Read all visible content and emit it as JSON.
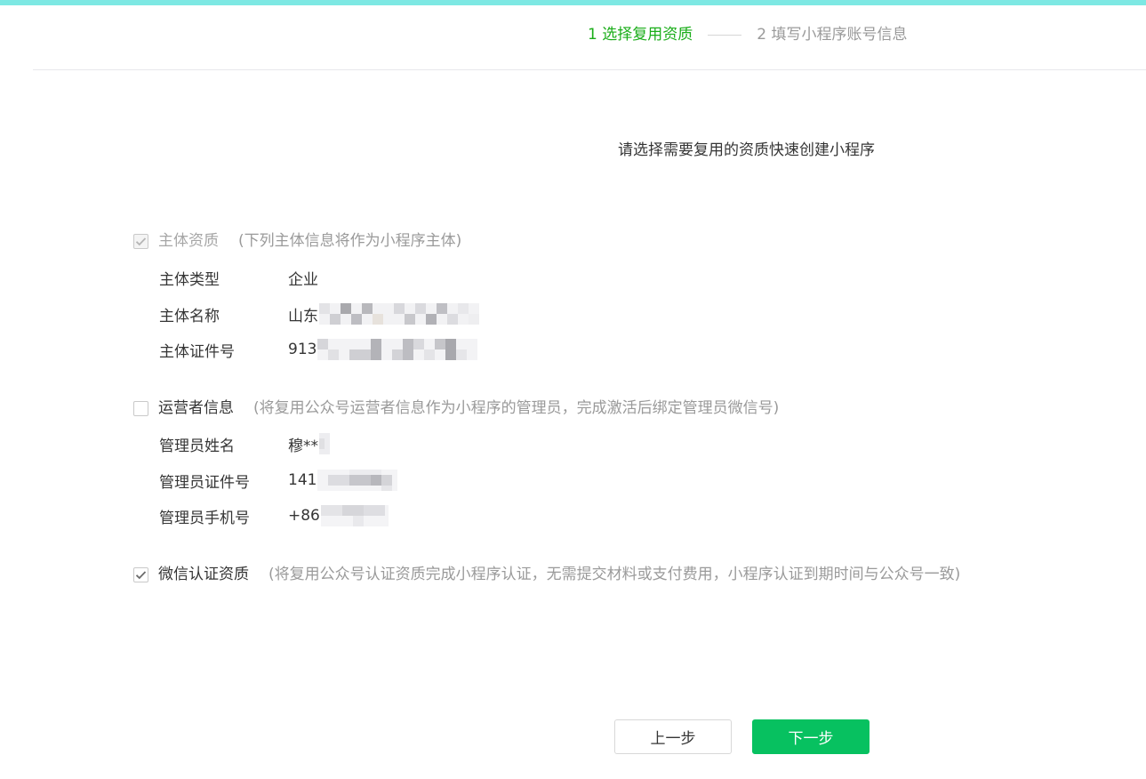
{
  "stepper": {
    "step1": "1 选择复用资质",
    "step2": "2 填写小程序账号信息"
  },
  "instruction": "请选择需要复用的资质快速创建小程序",
  "entity_section": {
    "title": "主体资质",
    "description": "(下列主体信息将作为小程序主体)",
    "checked": true,
    "disabled": true,
    "rows": [
      {
        "label": "主体类型",
        "value": "企业"
      },
      {
        "label": "主体名称",
        "value": "山东"
      },
      {
        "label": "主体证件号",
        "value": "913"
      }
    ]
  },
  "operator_section": {
    "title": "运营者信息",
    "description": "(将复用公众号运营者信息作为小程序的管理员，完成激活后绑定管理员微信号)",
    "checked": false,
    "rows": [
      {
        "label": "管理员姓名",
        "value": "穆**"
      },
      {
        "label": "管理员证件号",
        "value": "141"
      },
      {
        "label": "管理员手机号",
        "value": "+86"
      }
    ]
  },
  "wechat_cert_section": {
    "title": "微信认证资质",
    "description": "(将复用公众号认证资质完成小程序认证，无需提交材料或支付费用，小程序认证到期时间与公众号一致)",
    "checked": true
  },
  "buttons": {
    "prev": "上一步",
    "next": "下一步"
  },
  "colors": {
    "accent_bar": "#7de8e3",
    "active_step": "#1aad19",
    "primary_button": "#07c160"
  },
  "icons": [
    "check-icon"
  ]
}
